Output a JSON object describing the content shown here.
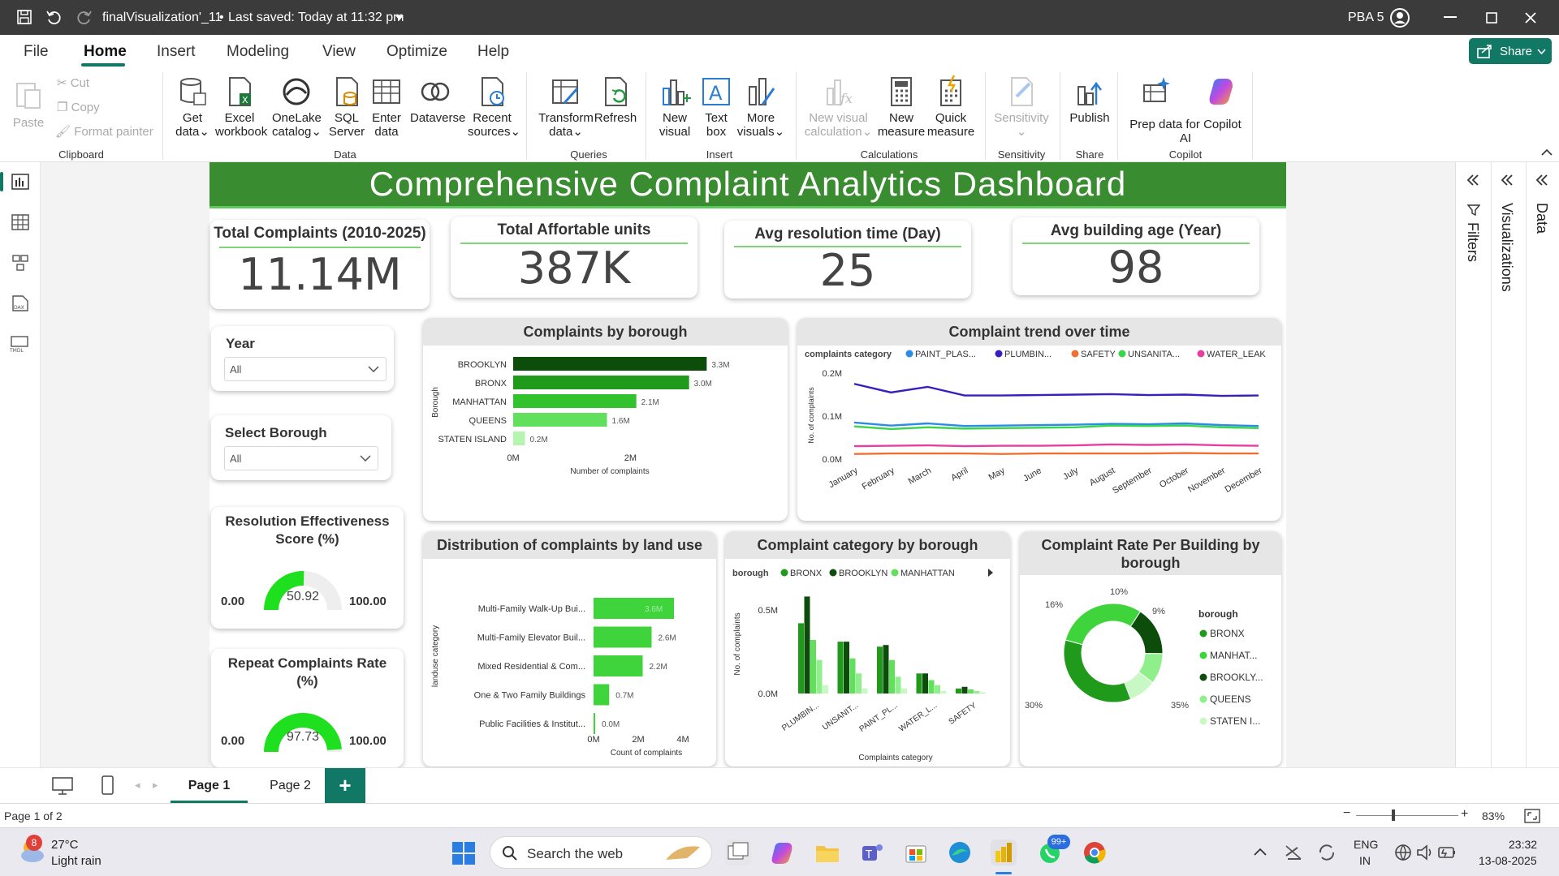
{
  "titlebar": {
    "filename": "finalVisualization'_11",
    "saved": "Last saved: Today at 11:32 pm",
    "user": "PBA 5"
  },
  "menu": {
    "items": [
      "File",
      "Home",
      "Insert",
      "Modeling",
      "View",
      "Optimize",
      "Help"
    ],
    "share": "Share"
  },
  "ribbon": {
    "clipboard": {
      "paste": "Paste",
      "cut": "Cut",
      "copy": "Copy",
      "format_painter": "Format painter",
      "group": "Clipboard"
    },
    "data": {
      "get_data": [
        "Get",
        "data"
      ],
      "excel": [
        "Excel",
        "workbook"
      ],
      "onelake": [
        "OneLake",
        "catalog"
      ],
      "sql": [
        "SQL",
        "Server"
      ],
      "enter": [
        "Enter",
        "data"
      ],
      "dataverse": [
        "Dataverse",
        ""
      ],
      "recent": [
        "Recent",
        "sources"
      ],
      "group": "Data"
    },
    "queries": {
      "transform": [
        "Transform",
        "data"
      ],
      "refresh": [
        "Refresh",
        ""
      ],
      "group": "Queries"
    },
    "insert": {
      "new_visual": [
        "New",
        "visual"
      ],
      "text_box": [
        "Text",
        "box"
      ],
      "more_visuals": [
        "More",
        "visuals"
      ],
      "group": "Insert"
    },
    "calculations": {
      "new_visual_calc": [
        "New visual",
        "calculation"
      ],
      "new_measure": [
        "New",
        "measure"
      ],
      "quick_measure": [
        "Quick",
        "measure"
      ],
      "group": "Calculations"
    },
    "sensitivity": {
      "label": [
        "Sensitivity",
        ""
      ],
      "group": "Sensitivity"
    },
    "share": {
      "publish": [
        "Publish",
        ""
      ],
      "group": "Share"
    },
    "copilot": {
      "prep": [
        "Prep data for Copilot",
        "AI"
      ],
      "group": "Copilot"
    }
  },
  "report": {
    "title": "Comprehensive Complaint Analytics Dashboard",
    "kpis": [
      {
        "title": "Total Complaints (2010-2025)",
        "value": "11.14M"
      },
      {
        "title": "Total Affortable units",
        "value": "387K"
      },
      {
        "title": "Avg resolution time (Day)",
        "value": "25"
      },
      {
        "title": "Avg building age (Year)",
        "value": "98"
      }
    ],
    "slicers": [
      {
        "title": "Year",
        "value": "All"
      },
      {
        "title": "Select Borough",
        "value": "All"
      }
    ],
    "gauges": [
      {
        "title": "Resolution Effectiveness Score (%)",
        "value": 50.92,
        "display": "50.92",
        "min": "0.00",
        "max": "100.00"
      },
      {
        "title": "Repeat Complaints Rate (%)",
        "value": 97.73,
        "display": "97.73",
        "min": "0.00",
        "max": "100.00"
      }
    ]
  },
  "chart_data": [
    {
      "type": "bar",
      "title": "Complaints by borough",
      "categories": [
        "BROOKLYN",
        "BRONX",
        "MANHATTAN",
        "QUEENS",
        "STATEN ISLAND"
      ],
      "values": [
        3.3,
        3.0,
        2.1,
        1.6,
        0.2
      ],
      "labels": [
        "3.3M",
        "3.0M",
        "2.1M",
        "1.6M",
        "0.2M"
      ],
      "xlabel": "Number of complaints",
      "ylabel": "Borough",
      "xticks": [
        "0M",
        "2M"
      ],
      "xlim": [
        0,
        3.6
      ],
      "colors": [
        "#0d4d0b",
        "#1f9a1a",
        "#32c22e",
        "#62e05d",
        "#b5f5b0"
      ]
    },
    {
      "type": "line",
      "title": "Complaint trend over time",
      "legend_title": "complaints category",
      "x": [
        "January",
        "February",
        "March",
        "April",
        "May",
        "June",
        "July",
        "August",
        "September",
        "October",
        "November",
        "December"
      ],
      "ylabel": "No. of complaints",
      "yticks": [
        "0.0M",
        "0.1M",
        "0.2M"
      ],
      "ylim": [
        0,
        0.2
      ],
      "series": [
        {
          "name": "PAINT_PLAS...",
          "color": "#2b8ce6",
          "values": [
            0.085,
            0.078,
            0.083,
            0.077,
            0.078,
            0.079,
            0.08,
            0.082,
            0.081,
            0.083,
            0.079,
            0.077
          ]
        },
        {
          "name": "PLUMBIN...",
          "color": "#3a1fbf",
          "values": [
            0.175,
            0.155,
            0.168,
            0.148,
            0.148,
            0.149,
            0.15,
            0.151,
            0.149,
            0.15,
            0.147,
            0.148
          ]
        },
        {
          "name": "SAFETY",
          "color": "#f07030",
          "values": [
            0.012,
            0.013,
            0.013,
            0.013,
            0.012,
            0.013,
            0.013,
            0.013,
            0.013,
            0.014,
            0.013,
            0.013
          ]
        },
        {
          "name": "UNSANITA...",
          "color": "#38d64a",
          "values": [
            0.076,
            0.07,
            0.074,
            0.071,
            0.072,
            0.073,
            0.074,
            0.078,
            0.077,
            0.078,
            0.074,
            0.072
          ]
        },
        {
          "name": "WATER_LEAK",
          "color": "#e83ea0",
          "values": [
            0.03,
            0.031,
            0.032,
            0.03,
            0.031,
            0.031,
            0.032,
            0.034,
            0.033,
            0.034,
            0.032,
            0.031
          ]
        }
      ]
    },
    {
      "type": "bar",
      "title": "Distribution of complaints by land use",
      "categories": [
        "Multi-Family Walk-Up Bui...",
        "Multi-Family Elevator Buil...",
        "Mixed Residential & Com...",
        "One & Two Family Buildings",
        "Public Facilities & Institut..."
      ],
      "values": [
        3.6,
        2.6,
        2.2,
        0.7,
        0.0
      ],
      "labels": [
        "3.6M",
        "2.6M",
        "2.2M",
        "0.7M",
        "0.0M"
      ],
      "xlabel": "Count of complaints",
      "ylabel": "landuse category",
      "xticks": [
        "0M",
        "2M",
        "4M"
      ],
      "xlim": [
        0,
        4
      ],
      "color": "#3fd43b"
    },
    {
      "type": "bar",
      "title": "Complaint category by borough",
      "legend_title": "borough",
      "categories": [
        "PLUMBIN...",
        "UNSANIT...",
        "PAINT_PL...",
        "WATER_L...",
        "SAFETY"
      ],
      "xlabel": "Complaints category",
      "ylabel": "No. of complaints",
      "yticks": [
        "0.0M",
        "0.5M"
      ],
      "ylim": [
        0,
        0.65
      ],
      "series": [
        {
          "name": "BRONX",
          "color": "#1f9a1a",
          "values": [
            0.42,
            0.31,
            0.28,
            0.12,
            0.03
          ]
        },
        {
          "name": "BROOKLYN",
          "color": "#0d4d0b",
          "values": [
            0.58,
            0.31,
            0.29,
            0.12,
            0.04
          ]
        },
        {
          "name": "MANHATTAN",
          "color": "#62e05d",
          "values": [
            0.32,
            0.21,
            0.2,
            0.08,
            0.025
          ]
        },
        {
          "name": "",
          "color": "#8fef8a",
          "values": [
            0.2,
            0.12,
            0.1,
            0.05,
            0.015
          ]
        },
        {
          "name": "",
          "color": "#c8f8c4",
          "values": [
            0.05,
            0.03,
            0.03,
            0.015,
            0.008
          ]
        }
      ]
    },
    {
      "type": "pie",
      "title": "Complaint Rate Per Building by borough",
      "legend_title": "borough",
      "categories": [
        "BRONX",
        "MANHAT...",
        "BROOKLY...",
        "QUEENS",
        "STATEN I..."
      ],
      "values": [
        35,
        30,
        16,
        10,
        9
      ],
      "labels": [
        "35%",
        "30%",
        "16%",
        "10%",
        "9%"
      ],
      "colors": [
        "#1f9a1a",
        "#3fd43b",
        "#0d4d0b",
        "#8fef8a",
        "#c8f8c4"
      ]
    }
  ],
  "pages": {
    "tabs": [
      "Page 1",
      "Page 2"
    ],
    "add": "+",
    "status": "Page 1 of 2",
    "zoom": "83%"
  },
  "panes": {
    "filters": "Filters",
    "visualizations": "Visualizations",
    "data": "Data"
  },
  "taskbar": {
    "temp": "27°C",
    "weather": "Light rain",
    "badge": "8",
    "search": "Search the web",
    "whatsapp_badge": "99+",
    "lang": "ENG",
    "region": "IN",
    "time": "23:32",
    "date": "13-08-2025"
  }
}
